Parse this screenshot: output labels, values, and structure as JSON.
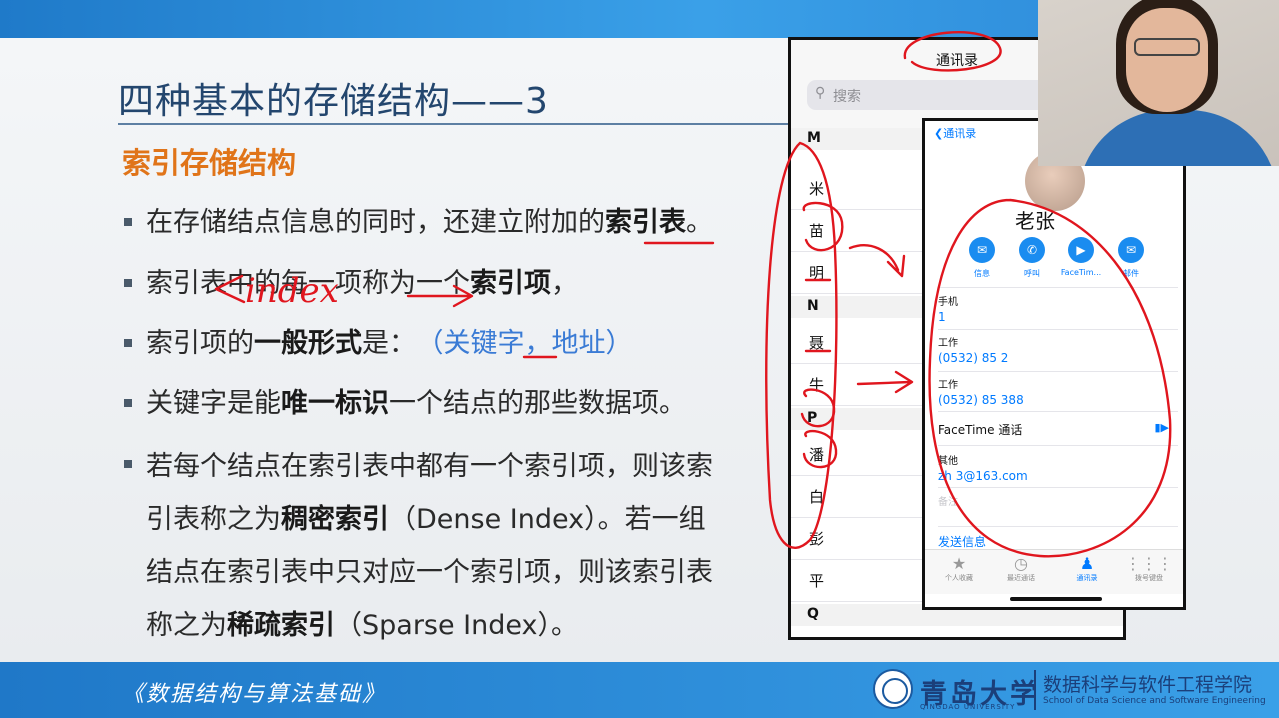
{
  "slide": {
    "title": "四种基本的存储结构——3",
    "subtitle": "索引存储结构",
    "bullet1": {
      "a": "在存储结点信息的同时，还建立附加的",
      "b": "索引表",
      "c": "。"
    },
    "bullet2": {
      "a": "索引表中的每一项称为一个",
      "b": "索引项",
      "c": "，"
    },
    "bullet3": {
      "a": "索引项的",
      "b": "一般形式",
      "c": "是：",
      "d": "（关键字，地址）"
    },
    "bullet4": {
      "a": "关键字是能",
      "b": "唯一标识",
      "c": "一个结点的那些数据项。"
    },
    "bullet5": {
      "l1": "若每个结点在索引表中都有一个索引项，则该索",
      "l2a": "引表称之为",
      "l2b": "稠密索引",
      "l2c": "（Dense Index）。若一组",
      "l3": "结点在索引表中只对应一个索引项，则该索引表",
      "l4a": "称之为",
      "l4b": "稀疏索引",
      "l4c": "（Sparse Index）。"
    },
    "annotation": "index"
  },
  "footer": {
    "book": "《数据结构与算法基础》",
    "university": "青岛大学",
    "university_en": "QINGDAO UNIVERSITY",
    "school_cn": "数据科学与软件工程学院",
    "school_en": "School of Data Science and Software Engineering"
  },
  "phone_list": {
    "title": "通讯录",
    "search_placeholder": "搜索",
    "search_icon": "search-icon",
    "sections": [
      "M",
      "N",
      "P",
      "Q"
    ],
    "rows": [
      "米",
      "苗",
      "明",
      "聂",
      "牛",
      "潘",
      "白",
      "彭",
      "平"
    ]
  },
  "phone_detail": {
    "back_label": "通讯录",
    "name": "老张",
    "actions": [
      {
        "label": "信息",
        "icon": "message-icon"
      },
      {
        "label": "呼叫",
        "icon": "phone-icon"
      },
      {
        "label": "FaceTim...",
        "icon": "video-icon"
      },
      {
        "label": "邮件",
        "icon": "mail-icon"
      }
    ],
    "fields": [
      {
        "label": "手机",
        "value": "1"
      },
      {
        "label": "工作",
        "value": "(0532) 85 2"
      },
      {
        "label": "工作",
        "value": "(0532) 85 388"
      }
    ],
    "facetime_label": "FaceTime 通话",
    "other_label": "其他",
    "other_value": "zh 3@163.com",
    "note_label": "备注",
    "send_label": "发送信息",
    "tabs": [
      {
        "label": "个人收藏",
        "icon": "star-icon"
      },
      {
        "label": "最近通话",
        "icon": "clock-icon"
      },
      {
        "label": "通讯录",
        "icon": "contacts-icon"
      },
      {
        "label": "拨号键盘",
        "icon": "keypad-icon"
      }
    ],
    "active_tab": "通讯录"
  },
  "colors": {
    "title": "#23466e",
    "subtitle": "#e07419",
    "link_blue": "#007aff",
    "annotation_red": "#e0161e",
    "footer_bar": "#2b8ad8"
  }
}
